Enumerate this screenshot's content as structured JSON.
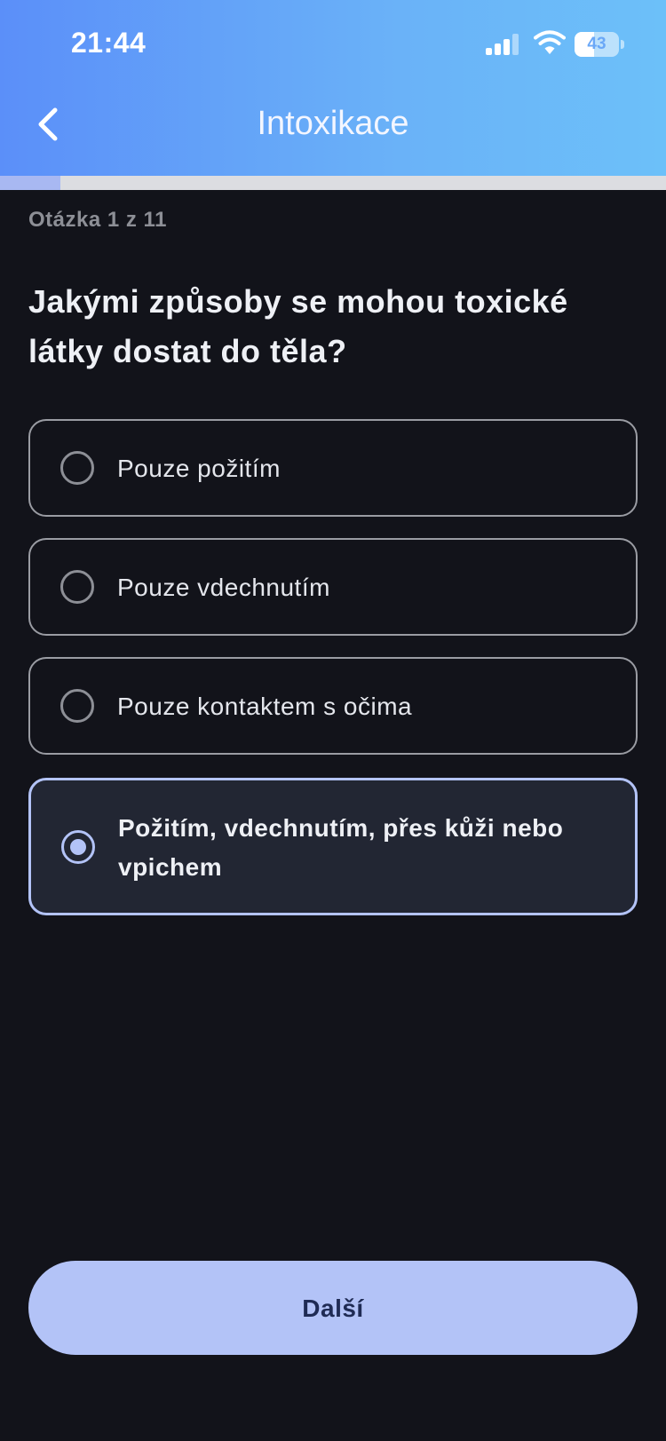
{
  "status_bar": {
    "time": "21:44",
    "battery": "43",
    "battery_fraction": 0.43,
    "signal_bars_active": 3,
    "signal_bars_total": 4
  },
  "nav": {
    "title": "Intoxikace",
    "back_icon": "chevron-left-icon"
  },
  "progress": {
    "current": 1,
    "total": 11,
    "fraction": 0.0909
  },
  "question": {
    "counter": "Otázka 1 z 11",
    "text": "Jakými způsoby se mohou toxické látky dostat do těla?"
  },
  "options": [
    {
      "label": "Pouze požitím",
      "selected": false
    },
    {
      "label": "Pouze vdechnutím",
      "selected": false
    },
    {
      "label": "Pouze kontaktem s očima",
      "selected": false
    },
    {
      "label": "Požitím, vdechnutím, přes kůži nebo vpichem",
      "selected": true
    }
  ],
  "actions": {
    "next_label": "Další"
  },
  "colors": {
    "accent": "#b3c3f7",
    "background": "#12131a",
    "header_start": "#5b8ff9",
    "header_end": "#6cc0f9",
    "button_text": "#1f2b54"
  }
}
